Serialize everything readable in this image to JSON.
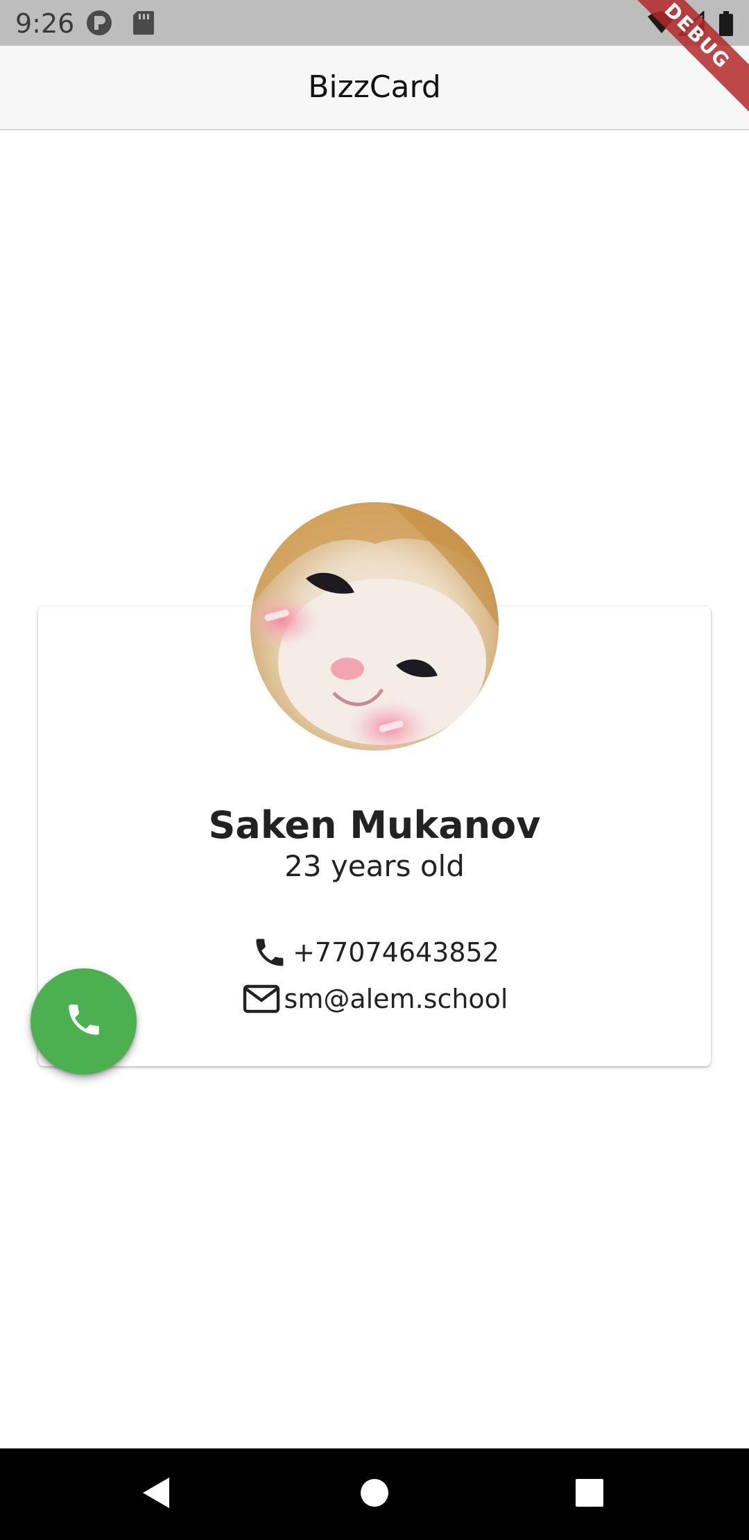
{
  "status_bar": {
    "time": "9:26",
    "left_icons": [
      "record-icon",
      "sd-card-icon"
    ],
    "right_icons": [
      "wifi-icon",
      "signal-icon",
      "battery-icon"
    ]
  },
  "debug_banner": "DEBUG",
  "app_bar": {
    "title": "BizzCard"
  },
  "profile": {
    "avatar": "cat-avatar",
    "name": "Saken Mukanov",
    "age": "23 years old",
    "phone": "+77074643852",
    "email": "sm@alem.school"
  },
  "fab": {
    "icon": "phone-icon",
    "color": "#4caf50"
  },
  "nav_bar": {
    "buttons": [
      "back-icon",
      "home-icon",
      "recents-icon"
    ]
  }
}
